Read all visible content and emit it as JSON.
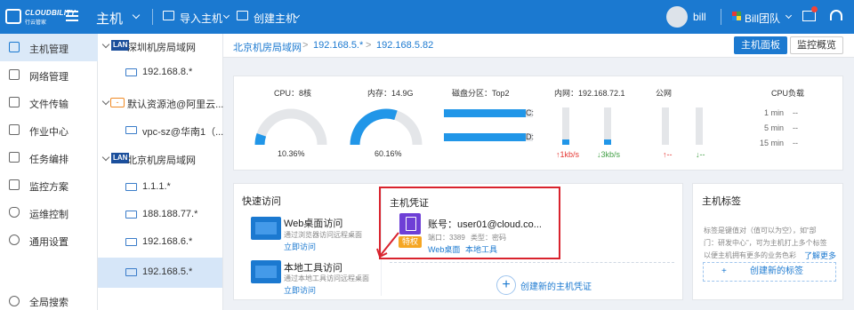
{
  "topbar": {
    "logo_text": "CLOUDBILITY",
    "logo_sub": "行云管家",
    "title": "主机",
    "import_host": "导入主机",
    "create_host": "创建主机",
    "user": "bill",
    "team": "Bill团队"
  },
  "sidebar": {
    "items": [
      {
        "label": "主机管理",
        "icon": "monitor-icon"
      },
      {
        "label": "网络管理",
        "icon": "network-icon"
      },
      {
        "label": "文件传输",
        "icon": "file-icon"
      },
      {
        "label": "作业中心",
        "icon": "job-icon"
      },
      {
        "label": "任务编排",
        "icon": "task-icon"
      },
      {
        "label": "监控方案",
        "icon": "chart-icon"
      },
      {
        "label": "运维控制",
        "icon": "shield-icon"
      },
      {
        "label": "通用设置",
        "icon": "gear-icon"
      },
      {
        "label": "全局搜索",
        "icon": "search-icon"
      }
    ]
  },
  "tree": {
    "groups": [
      {
        "type": "LAN",
        "label": "深圳机房局域网",
        "children": [
          "192.168.8.*"
        ]
      },
      {
        "type": "cloud",
        "label": "默认资源池@阿里云...",
        "children": [
          "vpc-sz@华南1（..."
        ]
      },
      {
        "type": "LAN",
        "label": "北京机房局域网",
        "children": [
          "1.1.1.*",
          "188.188.77.*",
          "192.168.6.*",
          "192.168.5.*"
        ]
      }
    ],
    "lan_badge": "LAN"
  },
  "breadcrumb": {
    "items": [
      "北京机房局域网",
      "192.168.5.*",
      "192.168.5.82"
    ],
    "sep": ">",
    "tab_host_panel": "主机面板",
    "tab_monitor": "监控概览"
  },
  "stats": {
    "cpu_label": "CPU：8核",
    "cpu_value": "10.36%",
    "cpu_pct": 10.36,
    "mem_label": "内存：14.9G",
    "mem_value": "60.16%",
    "mem_pct": 60.16,
    "disk_label": "磁盘分区：Top2",
    "disk_1": "C:",
    "disk_2": "D:",
    "intranet_label": "内网：192.168.72.1",
    "up": "↑1kb/s",
    "down": "↓3kb/s",
    "public_label": "公网",
    "pub_up": "↑--",
    "pub_down": "↓--",
    "load_label": "CPU负载",
    "load_rows": [
      {
        "t": "1 min",
        "v": "--"
      },
      {
        "t": "5 min",
        "v": "--"
      },
      {
        "t": "15 min",
        "v": "--"
      }
    ]
  },
  "quick": {
    "title": "快速访问",
    "web_name": "Web桌面访问",
    "web_desc": "通过浏览器访问远程桌面",
    "web_link": "立即访问",
    "local_name": "本地工具访问",
    "local_desc": "通过本地工具访问远程桌面",
    "local_link": "立即访问"
  },
  "cred": {
    "title": "主机凭证",
    "account": "账号：user01@cloud.co...",
    "port": "端口：3389",
    "type": "类型：密码",
    "badge": "特权",
    "link_web": "Web桌面",
    "link_local": "本地工具",
    "create": "创建新的主机凭证"
  },
  "tags": {
    "title": "主机标签",
    "desc_1": "标签是键值对（值可以为空），如“部",
    "desc_2": "门：研发中心”，可为主机打上多个标签",
    "desc_3": "以便主机拥有更多的业务色彩",
    "learn_more": "了解更多",
    "create": "创建新的标签",
    "plus": "+"
  },
  "colors": {
    "brand": "#1b79d0",
    "highlight": "#d9232d",
    "badge": "#f5a623"
  }
}
